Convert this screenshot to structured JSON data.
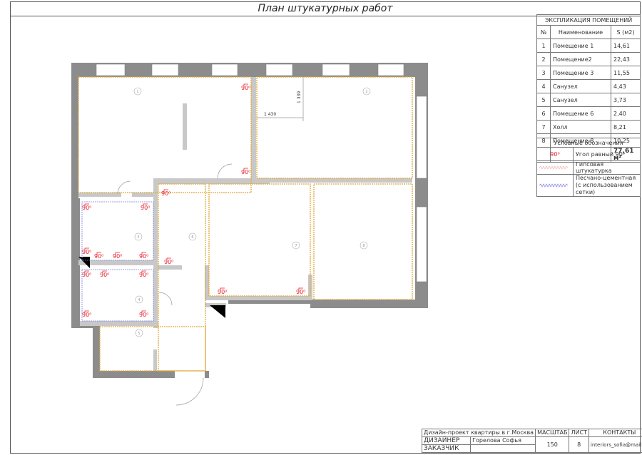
{
  "title": "План штукатурных работ",
  "explication": {
    "title": "ЭКСПЛИКАЦИЯ ПОМЕЩЕНИЙ",
    "headers": [
      "№",
      "Наименование",
      "S (м2)"
    ],
    "rows": [
      {
        "n": "1",
        "name": "Помещение 1",
        "area": "14,61"
      },
      {
        "n": "2",
        "name": "Помещение2",
        "area": "22,43"
      },
      {
        "n": "3",
        "name": "Помещение 3",
        "area": "11,55"
      },
      {
        "n": "4",
        "name": "Санузел",
        "area": "4,43"
      },
      {
        "n": "5",
        "name": "Санузел",
        "area": "3,73"
      },
      {
        "n": "6",
        "name": "Помещение 6",
        "area": "2,40"
      },
      {
        "n": "7",
        "name": "Холл",
        "area": "8,21"
      },
      {
        "n": "8",
        "name": "Помещение 8",
        "area": "10,25"
      }
    ],
    "total": "77,61 м²"
  },
  "legend": {
    "title": "Условные обозначения",
    "items": [
      {
        "symbol": "90⁰",
        "label": "Угол равный 90⁰"
      },
      {
        "label": "Гипсовая штукатурка"
      },
      {
        "label": "Песчано-цементная (с использованием сетки)"
      }
    ]
  },
  "stamp": {
    "project": "Дизайн-проект квартиры в г.Москва",
    "designer_label": "ДИЗАЙНЕР",
    "designer": "Горелова Софья",
    "client_label": "ЗАКАЗЧИК",
    "scale_label": "МАСШТАБ",
    "scale": "150",
    "sheet_label": "ЛИСТ",
    "sheet": "8",
    "contacts_label": "КОНТАКТЫ",
    "contacts": "interiors_sofia@mail.ru"
  },
  "plan": {
    "angle_label": "90⁰",
    "dim_h": "1 430",
    "dim_v": "1 339",
    "rooms": [
      "1",
      "2",
      "3",
      "4",
      "5",
      "6",
      "7",
      "8"
    ],
    "colors": {
      "wall": "#8c8c8c",
      "partition": "#c8c8c8",
      "gypsum": "#e0a93a",
      "cement": "#7d7de0",
      "angle": "#e8202a"
    }
  }
}
